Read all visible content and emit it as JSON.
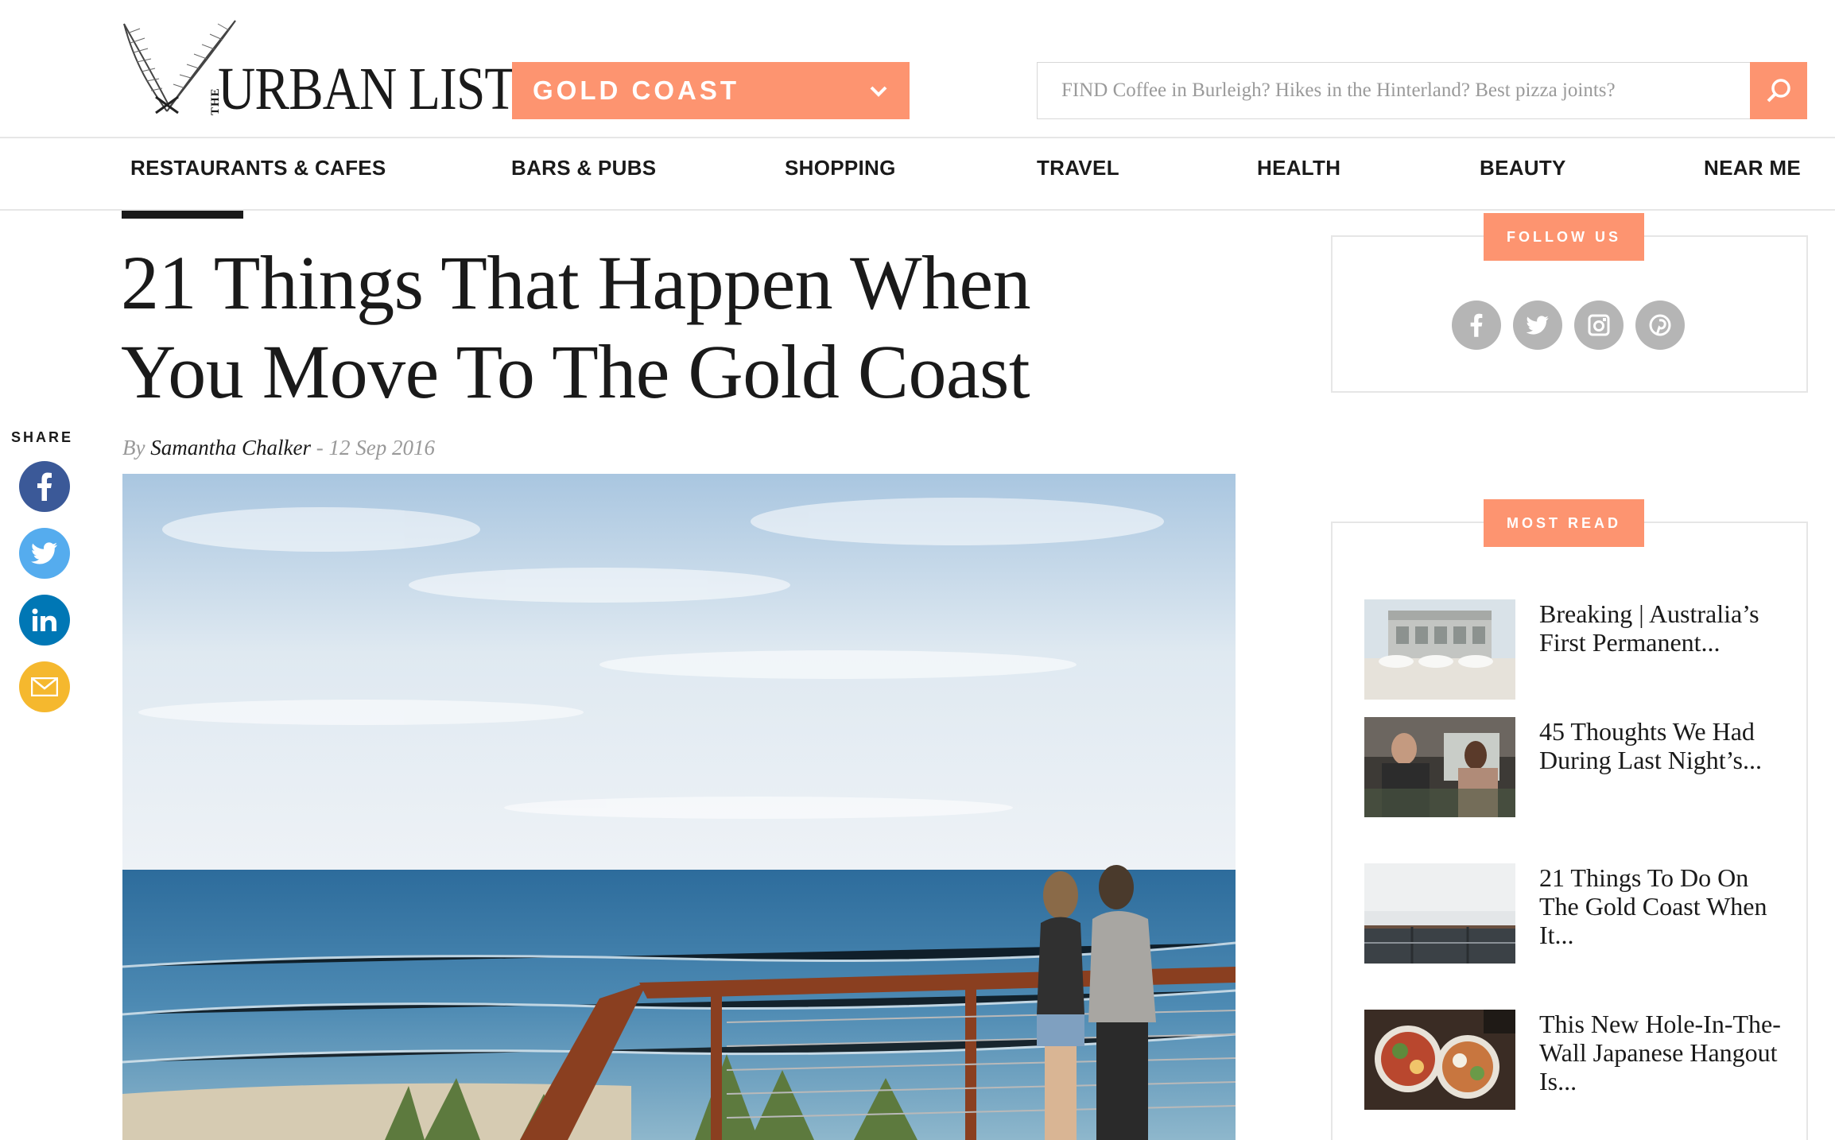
{
  "header": {
    "logo_text": "URBAN LIST",
    "logo_the": "THE",
    "city_label": "GOLD COAST",
    "search_placeholder": "FIND Coffee in Burleigh? Hikes in the Hinterland? Best pizza joints?"
  },
  "nav": {
    "items": [
      "RESTAURANTS & CAFES",
      "BARS & PUBS",
      "SHOPPING",
      "TRAVEL",
      "HEALTH",
      "BEAUTY",
      "NEAR ME"
    ],
    "active": "RESTAURANTS & CAFES"
  },
  "share": {
    "label": "SHARE",
    "buttons": [
      {
        "icon": "facebook-icon",
        "color": "#3b5998"
      },
      {
        "icon": "twitter-icon",
        "color": "#55acee"
      },
      {
        "icon": "linkedin-icon",
        "color": "#0077b5"
      },
      {
        "icon": "email-icon",
        "color": "#f5b82e"
      }
    ]
  },
  "article": {
    "title_line1": "21 Things That Happen When",
    "title_line2": "You Move To The Gold Coast",
    "byline_prefix": "By",
    "author": "Samantha Chalker",
    "date": "- 12 Sep 2016"
  },
  "sidebar": {
    "follow_label": "FOLLOW US",
    "social_icons": [
      "facebook-icon",
      "twitter-icon",
      "instagram-icon",
      "pinterest-icon"
    ],
    "most_read_label": "MOST READ",
    "most_read": [
      "Breaking | Australia’s First Permanent...",
      "45 Thoughts We Had During Last Night’s...",
      "21 Things To Do On The Gold Coast When It...",
      "This New Hole-In-The-Wall Japanese Hangout Is..."
    ]
  },
  "colors": {
    "accent": "#fd9470",
    "text": "#1a1a1a",
    "muted": "#999999"
  }
}
